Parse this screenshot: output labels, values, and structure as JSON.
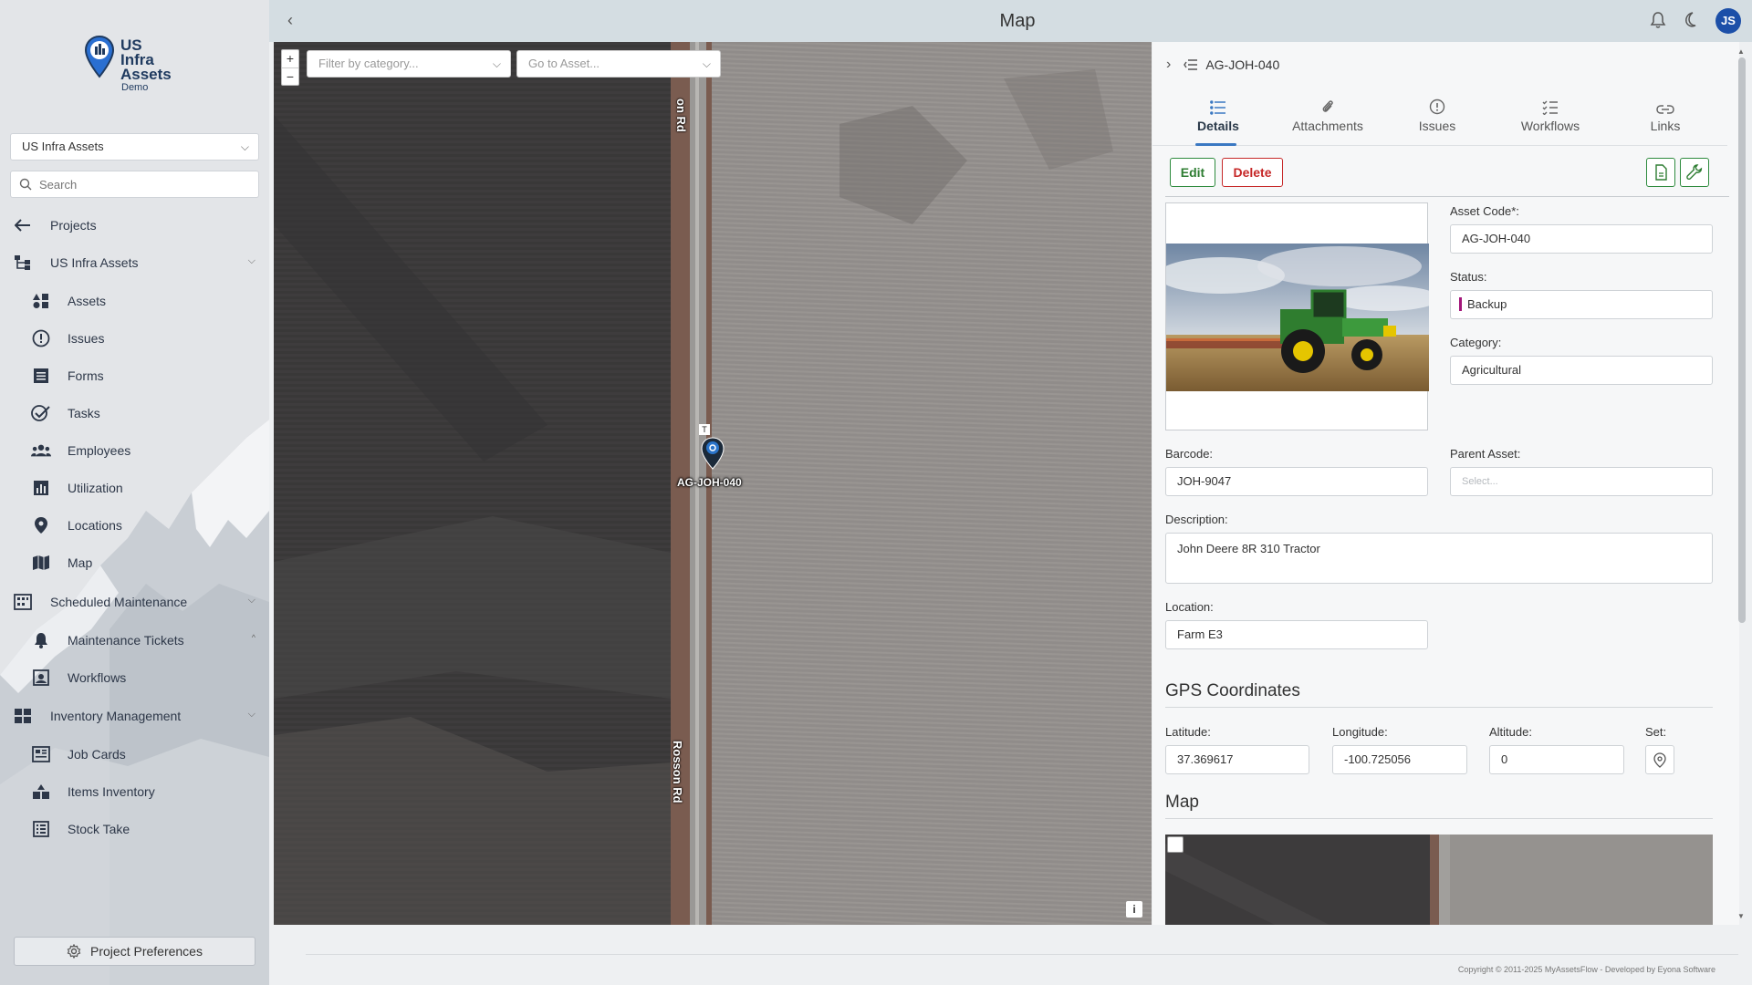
{
  "app": {
    "logo_line1": "US",
    "logo_line2": "Infra",
    "logo_line3": "Assets",
    "logo_sub": "Demo",
    "brand_color": "#1f3a5f"
  },
  "sidebar": {
    "project_select": "US Infra Assets",
    "search_placeholder": "Search",
    "projects": "Projects",
    "group_assets": "US Infra Assets",
    "items": [
      {
        "label": "Assets",
        "icon": "shapes-icon"
      },
      {
        "label": "Issues",
        "icon": "alert-circle-icon"
      },
      {
        "label": "Forms",
        "icon": "form-icon"
      },
      {
        "label": "Tasks",
        "icon": "task-check-icon"
      },
      {
        "label": "Employees",
        "icon": "users-icon"
      },
      {
        "label": "Utilization",
        "icon": "chart-icon"
      },
      {
        "label": "Locations",
        "icon": "location-pin-icon"
      },
      {
        "label": "Map",
        "icon": "map-icon"
      }
    ],
    "group_maintenance": "Scheduled Maintenance",
    "maintenance_items": [
      {
        "label": "Maintenance Tickets",
        "icon": "bell-icon"
      },
      {
        "label": "Workflows",
        "icon": "workflow-icon"
      }
    ],
    "group_inventory": "Inventory Management",
    "inventory_items": [
      {
        "label": "Job Cards",
        "icon": "job-card-icon"
      },
      {
        "label": "Items Inventory",
        "icon": "boxes-icon"
      },
      {
        "label": "Stock Take",
        "icon": "stock-list-icon"
      }
    ],
    "preferences": "Project Preferences"
  },
  "topbar": {
    "title": "Map",
    "avatar_initials": "JS",
    "avatar_color": "#1c4fa8"
  },
  "map": {
    "zoom_in": "+",
    "zoom_out": "−",
    "category_placeholder": "Filter by category...",
    "asset_placeholder": "Go to Asset...",
    "road_top": "on Rd",
    "road_bottom": "Rosson Rd",
    "marker_tag": "T",
    "marker_label": "AG-JOH-040",
    "info": "i"
  },
  "panel": {
    "asset_id": "AG-JOH-040",
    "tabs": [
      {
        "label": "Details",
        "icon": "list-icon"
      },
      {
        "label": "Attachments",
        "icon": "paperclip-icon"
      },
      {
        "label": "Issues",
        "icon": "info-circle-icon"
      },
      {
        "label": "Workflows",
        "icon": "checklist-icon"
      },
      {
        "label": "Links",
        "icon": "link-icon"
      }
    ],
    "edit": "Edit",
    "delete": "Delete",
    "fields": {
      "asset_code_label": "Asset Code*:",
      "asset_code": "AG-JOH-040",
      "status_label": "Status:",
      "status": "Backup",
      "status_color": "#a3167a",
      "category_label": "Category:",
      "category": "Agricultural",
      "barcode_label": "Barcode:",
      "barcode": "JOH-9047",
      "parent_label": "Parent Asset:",
      "parent_placeholder": "Select...",
      "description_label": "Description:",
      "description": "John Deere 8R 310 Tractor",
      "location_label": "Location:",
      "location": "Farm E3"
    },
    "gps": {
      "title": "GPS Coordinates",
      "lat_label": "Latitude:",
      "lat": "37.369617",
      "lon_label": "Longitude:",
      "lon": "-100.725056",
      "alt_label": "Altitude:",
      "alt": "0",
      "set_label": "Set:"
    },
    "map_title": "Map"
  },
  "footer": {
    "copyright": "Copyright © 2011-2025 MyAssetsFlow - Developed by Eyona Software"
  }
}
